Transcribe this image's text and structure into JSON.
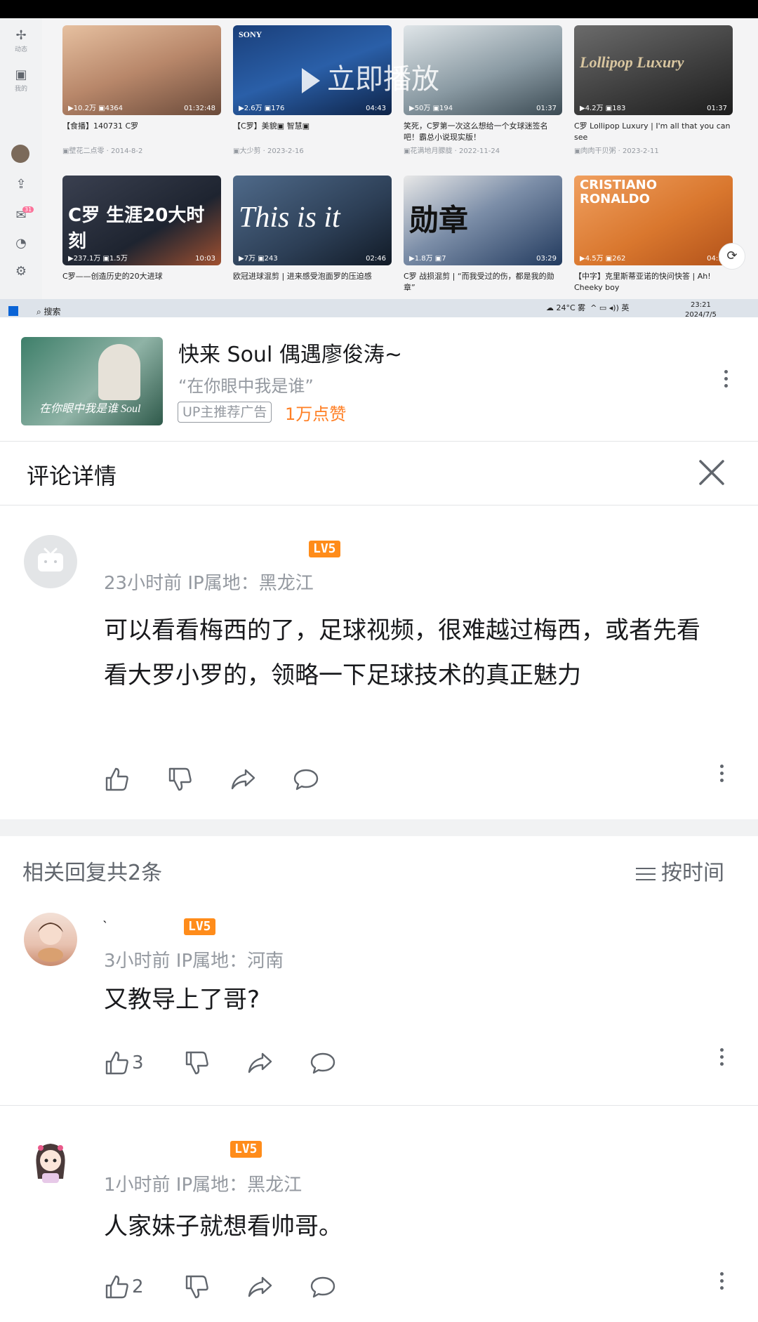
{
  "player": {
    "overlay_text": "立即播放",
    "sidebar": [
      {
        "icon": "fan-icon",
        "label": "动态"
      },
      {
        "icon": "tv-icon",
        "label": "我的"
      }
    ],
    "sidebar_badge": "31",
    "videos": [
      {
        "stats": "▶10.2万  ▣4364",
        "duration": "01:32:48",
        "title": "【食播】140731 C罗",
        "author": "▣壁花二点零 · 2014-8-2",
        "bg": "#b8876a"
      },
      {
        "stats": "▶2.6万  ▣176",
        "duration": "04:43",
        "title": "【C罗】美貌▣ 智慧▣",
        "author": "▣大少剪 · 2023-2-16",
        "bg": "#2a5fa8",
        "logo": "SONY"
      },
      {
        "stats": "▶50万  ▣194",
        "duration": "01:37",
        "title": "笑死，C罗第一次这么想给一个女球迷签名吧！霸总小说现实版！",
        "author": "▣花满地月朦胧 · 2022-11-24",
        "bg": "#5a6b73"
      },
      {
        "stats": "▶4.2万  ▣183",
        "duration": "01:37",
        "title": "C罗 Lollipop Luxury | I'm all that you can see",
        "author": "▣肉肉干贝粥 · 2023-2-11",
        "bg": "#3b3b3b",
        "big": "Lollipop  Luxury"
      },
      {
        "stats": "▶237.1万  ▣1.5万",
        "duration": "10:03",
        "title": "C罗——创造历史的20大进球",
        "author": "",
        "bg": "#1e2430",
        "big": "C罗  生涯20大时刻"
      },
      {
        "stats": "▶7万  ▣243",
        "duration": "02:46",
        "title": "欧冠进球混剪 | 进来感受泡面罗的压迫感",
        "author": "",
        "bg": "#2c3e55",
        "big": "This is it"
      },
      {
        "stats": "▶1.8万  ▣7",
        "duration": "03:29",
        "title": "C罗 战损混剪 | “而我受过的伤，都是我的勋章”",
        "author": "",
        "bg": "#223a5e",
        "big": "勋章"
      },
      {
        "stats": "▶4.5万  ▣262",
        "duration": "04:58",
        "title": "【中字】克里斯蒂亚诺的快问快答 | Ah! Cheeky boy",
        "author": "",
        "bg": "#d9772e",
        "big": "CRISTIANO RONALDO"
      }
    ],
    "taskbar": {
      "search": "搜索",
      "weather": "24°C 雾",
      "ime": "英",
      "time": "23:21",
      "date": "2024/7/5"
    }
  },
  "ad": {
    "title": "快来 Soul 偶遇廖俊涛~",
    "subtitle": "“在你眼中我是谁”",
    "tag": "UP主推荐广告",
    "likes": "1万点赞",
    "thumb_text": "在你眼中我是谁 Soul"
  },
  "header": {
    "title": "评论详情"
  },
  "main_comment": {
    "level": "LV5",
    "meta": "23小时前  IP属地：黑龙江",
    "text": "可以看看梅西的了，足球视频，很难越过梅西，或者先看看大罗小罗的，领略一下足球技术的真正魅力"
  },
  "replies_header": {
    "count_text": "相关回复共2条",
    "sort_text": "按时间"
  },
  "replies": [
    {
      "level": "LV5",
      "meta": "3小时前  IP属地：河南",
      "text": "又教导上了哥?",
      "likes": "3"
    },
    {
      "level": "LV5",
      "meta": "1小时前  IP属地：黑龙江",
      "text": "人家妹子就想看帅哥。",
      "likes": "2"
    }
  ],
  "colors": {
    "accent_orange": "#ff7f24",
    "level_badge": "#ff8c1a",
    "text_secondary": "#9499a0"
  }
}
